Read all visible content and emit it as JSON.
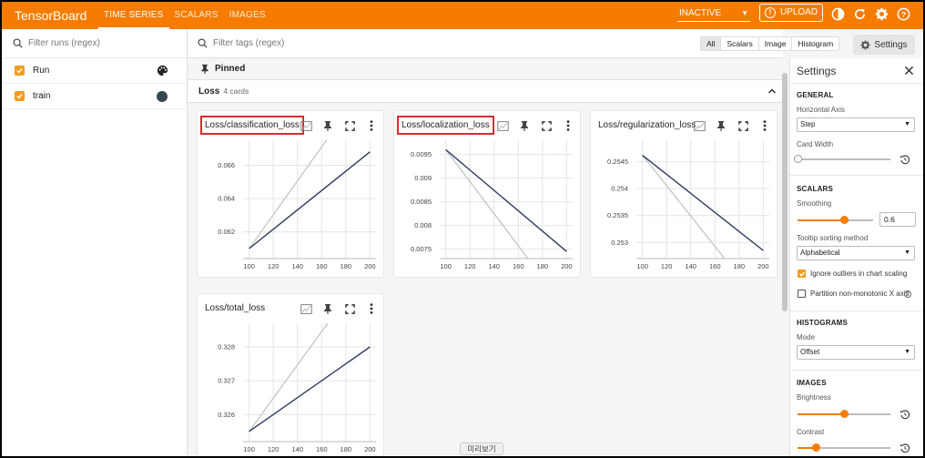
{
  "topbar": {
    "brand": "TensorBoard",
    "tabs": [
      "TIME SERIES",
      "SCALARS",
      "IMAGES"
    ],
    "status_select": "INACTIVE",
    "upload_label": "UPLOAD",
    "icons": [
      "theme-icon",
      "refresh-icon",
      "gear-icon",
      "help-icon"
    ],
    "accent": "#f57c00"
  },
  "runs": {
    "filter_placeholder": "Filter runs (regex)",
    "items": [
      {
        "label": "Run",
        "icon": "palette-icon"
      },
      {
        "label": "train",
        "color": "#37474f"
      }
    ]
  },
  "main": {
    "tag_filter_placeholder": "Filter tags (regex)",
    "type_buttons": [
      "All",
      "Scalars",
      "Image",
      "Histogram"
    ],
    "settings_button": "Settings",
    "pinned_label": "Pinned",
    "group": {
      "title": "Loss",
      "count": "4 cards"
    },
    "preview_label": "미리보기"
  },
  "cards": [
    {
      "title": "Loss/classification_loss"
    },
    {
      "title": "Loss/localization_loss"
    },
    {
      "title": "Loss/regularization_loss"
    },
    {
      "title": "Loss/total_loss"
    }
  ],
  "chart_data": [
    {
      "type": "line",
      "title": "Loss/classification_loss",
      "x_ticks": [
        "100",
        "120",
        "140",
        "160",
        "180",
        "200"
      ],
      "y_ticks": [
        "0.062",
        "0.064",
        "0.066"
      ],
      "xlim": [
        95,
        205
      ],
      "ylim": [
        0.0604,
        0.0675
      ],
      "series": [
        {
          "color": "#2e3a5c",
          "x": [
            100,
            200
          ],
          "y": [
            0.061,
            0.0668
          ]
        },
        {
          "color": "#c8c8cc",
          "x": [
            100,
            165
          ],
          "y": [
            0.061,
            0.0676
          ]
        }
      ]
    },
    {
      "type": "line",
      "title": "Loss/localization_loss",
      "x_ticks": [
        "100",
        "120",
        "140",
        "160",
        "180",
        "200"
      ],
      "y_ticks": [
        "0.0075",
        "0.008",
        "0.0085",
        "0.009",
        "0.0095"
      ],
      "xlim": [
        95,
        205
      ],
      "ylim": [
        0.0073,
        0.0098
      ],
      "series": [
        {
          "color": "#2e3a5c",
          "x": [
            100,
            200
          ],
          "y": [
            0.0096,
            0.00745
          ]
        },
        {
          "color": "#c8c8cc",
          "x": [
            100,
            168
          ],
          "y": [
            0.0096,
            0.0073
          ]
        }
      ]
    },
    {
      "type": "line",
      "title": "Loss/regularization_loss",
      "x_ticks": [
        "100",
        "120",
        "140",
        "160",
        "180",
        "200"
      ],
      "y_ticks": [
        "0.253",
        "0.2535",
        "0.254",
        "0.2545"
      ],
      "xlim": [
        95,
        205
      ],
      "ylim": [
        0.2527,
        0.2549
      ],
      "series": [
        {
          "color": "#2e3a5c",
          "x": [
            100,
            200
          ],
          "y": [
            0.25462,
            0.25285
          ]
        },
        {
          "color": "#c8c8cc",
          "x": [
            100,
            168
          ],
          "y": [
            0.25462,
            0.2527
          ]
        }
      ]
    },
    {
      "type": "line",
      "title": "Loss/total_loss",
      "x_ticks": [
        "100",
        "120",
        "140",
        "160",
        "180",
        "200"
      ],
      "y_ticks": [
        "0.326",
        "0.327",
        "0.328"
      ],
      "xlim": [
        95,
        205
      ],
      "ylim": [
        0.3252,
        0.3287
      ],
      "series": [
        {
          "color": "#2e3a5c",
          "x": [
            100,
            200
          ],
          "y": [
            0.3255,
            0.328
          ]
        },
        {
          "color": "#c8c8cc",
          "x": [
            100,
            165
          ],
          "y": [
            0.3255,
            0.3287
          ]
        }
      ]
    }
  ],
  "settings": {
    "title": "Settings",
    "general": {
      "heading": "GENERAL",
      "horizontal_axis_label": "Horizontal Axis",
      "horizontal_axis_value": "Step",
      "card_width_label": "Card Width",
      "card_width_level": 0
    },
    "scalars": {
      "heading": "SCALARS",
      "smoothing_label": "Smoothing",
      "smoothing_value": "0.6",
      "tooltip_label": "Tooltip sorting method",
      "tooltip_value": "Alphabetical",
      "ignore_outliers_label": "Ignore outliers in chart scaling",
      "ignore_outliers_checked": true,
      "partition_label": "Partition non-monotonic X axis",
      "partition_checked": false
    },
    "histograms": {
      "heading": "HISTOGRAMS",
      "mode_label": "Mode",
      "mode_value": "Offset"
    },
    "images": {
      "heading": "IMAGES",
      "brightness_label": "Brightness",
      "brightness_level": 0.5,
      "contrast_label": "Contrast",
      "contrast_level": 0.2
    }
  }
}
